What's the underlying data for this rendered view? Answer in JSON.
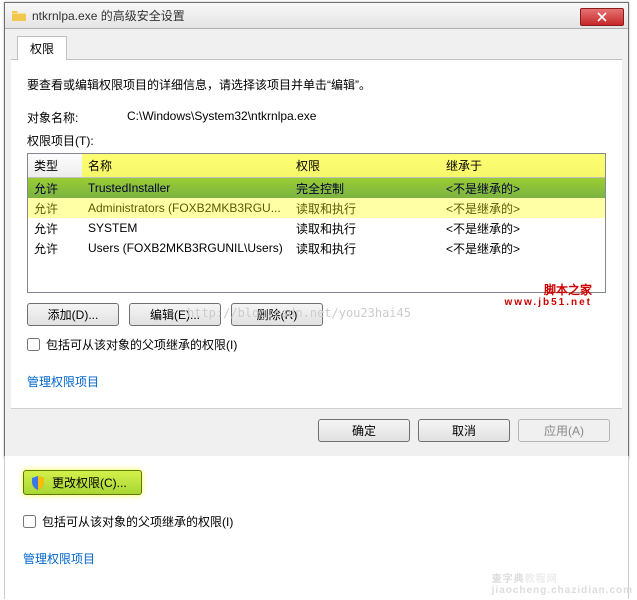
{
  "window": {
    "title": "ntkrnlpa.exe 的高级安全设置"
  },
  "tab": {
    "label": "权限"
  },
  "instruction": "要查看或编辑权限项目的详细信息，请选择该项目并单击“编辑”。",
  "object": {
    "label": "对象名称:",
    "path": "C:\\Windows\\System32\\ntkrnlpa.exe"
  },
  "perm_label": "权限项目(T):",
  "headers": {
    "type": "类型",
    "name": "名称",
    "perm": "权限",
    "inherit": "继承于"
  },
  "rows": [
    {
      "type": "允许",
      "name": "TrustedInstaller",
      "perm": "完全控制",
      "inherit": "<不是继承的>",
      "selected": true
    },
    {
      "type": "允许",
      "name": "Administrators (FOXB2MKB3RGU...",
      "perm": "读取和执行",
      "inherit": "<不是继承的>"
    },
    {
      "type": "允许",
      "name": "SYSTEM",
      "perm": "读取和执行",
      "inherit": "<不是继承的>"
    },
    {
      "type": "允许",
      "name": "Users (FOXB2MKB3RGUNIL\\Users)",
      "perm": "读取和执行",
      "inherit": "<不是继承的>"
    }
  ],
  "buttons": {
    "add": "添加(D)...",
    "edit": "编辑(E)...",
    "remove": "删除(R)"
  },
  "watermark": "http://blog.csdn.net/you23hai45",
  "brand": {
    "name": "脚本之家",
    "url": "www.jb51.net"
  },
  "include_label": "包括可从该对象的父项继承的权限(I)",
  "manage_link": "管理权限项目",
  "footer": {
    "ok": "确定",
    "cancel": "取消",
    "apply": "应用(A)"
  },
  "lower": {
    "change_perm": "更改权限(C)...",
    "include_label": "包括可从该对象的父项继承的权限(I)",
    "manage_link": "管理权限项目"
  },
  "wm2": {
    "a": "查字典",
    "b": "教程网",
    "c": "jiaocheng.chazidian.com"
  }
}
